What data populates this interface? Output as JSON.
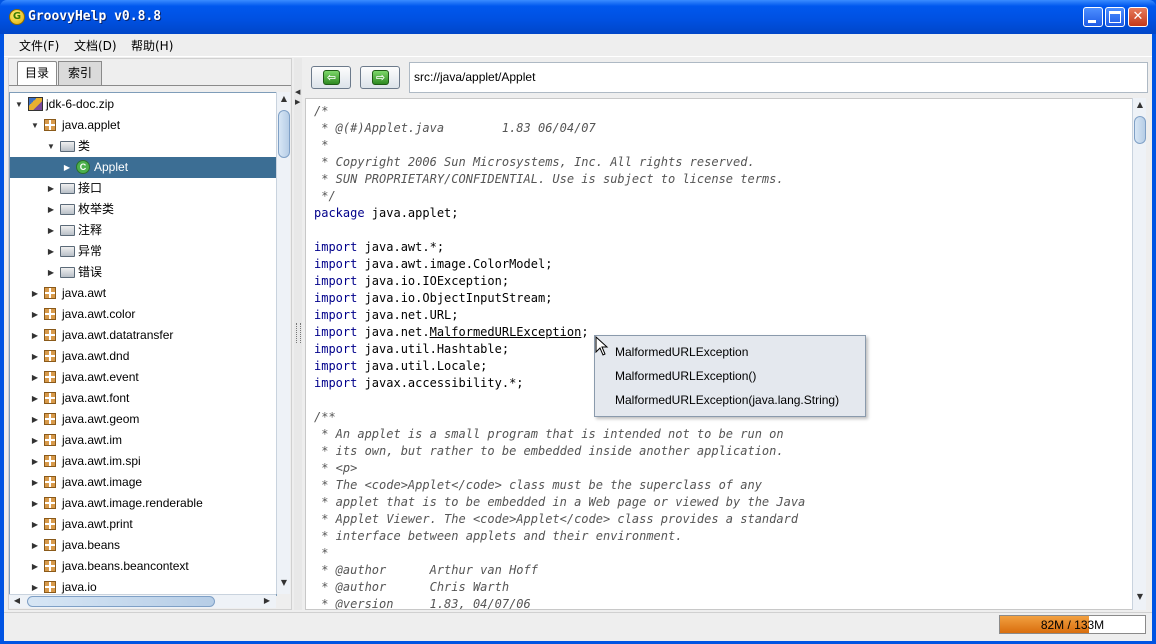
{
  "window": {
    "title": "GroovyHelp v0.8.8",
    "icon": "G"
  },
  "menu": [
    "文件(F)",
    "文档(D)",
    "帮助(H)"
  ],
  "left_tabs": [
    "目录",
    "索引"
  ],
  "tree": [
    {
      "label": "jdk-6-doc.zip",
      "depth": 0,
      "icon": "zip-icon",
      "exp": "▼"
    },
    {
      "label": "java.applet",
      "depth": 1,
      "icon": "package-icon",
      "exp": "▼"
    },
    {
      "label": "类",
      "depth": 2,
      "icon": "folder-icon",
      "exp": "▼"
    },
    {
      "label": "Applet",
      "depth": 3,
      "icon": "class-icon",
      "exp": "▶",
      "selected": true
    },
    {
      "label": "接口",
      "depth": 2,
      "icon": "folder-icon",
      "exp": "▶"
    },
    {
      "label": "枚举类",
      "depth": 2,
      "icon": "folder-icon",
      "exp": "▶"
    },
    {
      "label": "注释",
      "depth": 2,
      "icon": "folder-icon",
      "exp": "▶"
    },
    {
      "label": "异常",
      "depth": 2,
      "icon": "folder-icon",
      "exp": "▶"
    },
    {
      "label": "错误",
      "depth": 2,
      "icon": "folder-icon",
      "exp": "▶"
    },
    {
      "label": "java.awt",
      "depth": 1,
      "icon": "package-icon",
      "exp": "▶"
    },
    {
      "label": "java.awt.color",
      "depth": 1,
      "icon": "package-icon",
      "exp": "▶"
    },
    {
      "label": "java.awt.datatransfer",
      "depth": 1,
      "icon": "package-icon",
      "exp": "▶"
    },
    {
      "label": "java.awt.dnd",
      "depth": 1,
      "icon": "package-icon",
      "exp": "▶"
    },
    {
      "label": "java.awt.event",
      "depth": 1,
      "icon": "package-icon",
      "exp": "▶"
    },
    {
      "label": "java.awt.font",
      "depth": 1,
      "icon": "package-icon",
      "exp": "▶"
    },
    {
      "label": "java.awt.geom",
      "depth": 1,
      "icon": "package-icon",
      "exp": "▶"
    },
    {
      "label": "java.awt.im",
      "depth": 1,
      "icon": "package-icon",
      "exp": "▶"
    },
    {
      "label": "java.awt.im.spi",
      "depth": 1,
      "icon": "package-icon",
      "exp": "▶"
    },
    {
      "label": "java.awt.image",
      "depth": 1,
      "icon": "package-icon",
      "exp": "▶"
    },
    {
      "label": "java.awt.image.renderable",
      "depth": 1,
      "icon": "package-icon",
      "exp": "▶"
    },
    {
      "label": "java.awt.print",
      "depth": 1,
      "icon": "package-icon",
      "exp": "▶"
    },
    {
      "label": "java.beans",
      "depth": 1,
      "icon": "package-icon",
      "exp": "▶"
    },
    {
      "label": "java.beans.beancontext",
      "depth": 1,
      "icon": "package-icon",
      "exp": "▶"
    },
    {
      "label": "java.io",
      "depth": 1,
      "icon": "package-icon",
      "exp": "▶"
    }
  ],
  "nav": {
    "back_icon": "back-arrow-icon",
    "forward_icon": "forward-arrow-icon"
  },
  "address": "src://java/applet/Applet",
  "code": [
    {
      "text": "/*",
      "cls": "cmt"
    },
    {
      "text": " * @(#)Applet.java        1.83 06/04/07",
      "cls": "cmt"
    },
    {
      "text": " *",
      "cls": "cmt"
    },
    {
      "text": " * Copyright 2006 Sun Microsystems, Inc. All rights reserved.",
      "cls": "cmt"
    },
    {
      "text": " * SUN PROPRIETARY/CONFIDENTIAL. Use is subject to license terms.",
      "cls": "cmt"
    },
    {
      "text": " */",
      "cls": "cmt"
    },
    {
      "kw": "package",
      "text": " java.applet;"
    },
    {
      "text": ""
    },
    {
      "kw": "import",
      "text": " java.awt.*;"
    },
    {
      "kw": "import",
      "text": " java.awt.image.ColorModel;"
    },
    {
      "kw": "import",
      "text": " java.io.IOException;"
    },
    {
      "kw": "import",
      "text": " java.io.ObjectInputStream;"
    },
    {
      "kw": "import",
      "text": " java.net.URL;"
    },
    {
      "kw": "import",
      "text": " java.net.",
      "ul": "MalformedURLException",
      "tail": ";"
    },
    {
      "kw": "import",
      "text": " java.util.Hashtable;"
    },
    {
      "kw": "import",
      "text": " java.util.Locale;"
    },
    {
      "kw": "import",
      "text": " javax.accessibility.*;"
    },
    {
      "text": ""
    },
    {
      "text": "/**",
      "cls": "cmt"
    },
    {
      "text": " * An applet is a small program that is intended not to be run on",
      "cls": "cmt"
    },
    {
      "text": " * its own, but rather to be embedded inside another application.",
      "cls": "cmt"
    },
    {
      "text": " * <p>",
      "cls": "cmt"
    },
    {
      "text": " * The <code>Applet</code> class must be the superclass of any",
      "cls": "cmt"
    },
    {
      "text": " * applet that is to be embedded in a Web page or viewed by the Java",
      "cls": "cmt"
    },
    {
      "text": " * Applet Viewer. The <code>Applet</code> class provides a standard",
      "cls": "cmt"
    },
    {
      "text": " * interface between applets and their environment.",
      "cls": "cmt"
    },
    {
      "text": " *",
      "cls": "cmt"
    },
    {
      "text": " * @author      Arthur van Hoff",
      "cls": "cmt"
    },
    {
      "text": " * @author      Chris Warth",
      "cls": "cmt"
    },
    {
      "text": " * @version     1.83, 04/07/06",
      "cls": "cmt"
    }
  ],
  "popup": [
    "MalformedURLException",
    "MalformedURLException()",
    "MalformedURLException(java.lang.String)"
  ],
  "memory": {
    "text": "82M / 133M",
    "used_fraction": 0.6165
  },
  "colors": {
    "selection": "#3C6E94",
    "keyword": "#00008B",
    "comment": "#555555",
    "memory": "#E0801E"
  }
}
